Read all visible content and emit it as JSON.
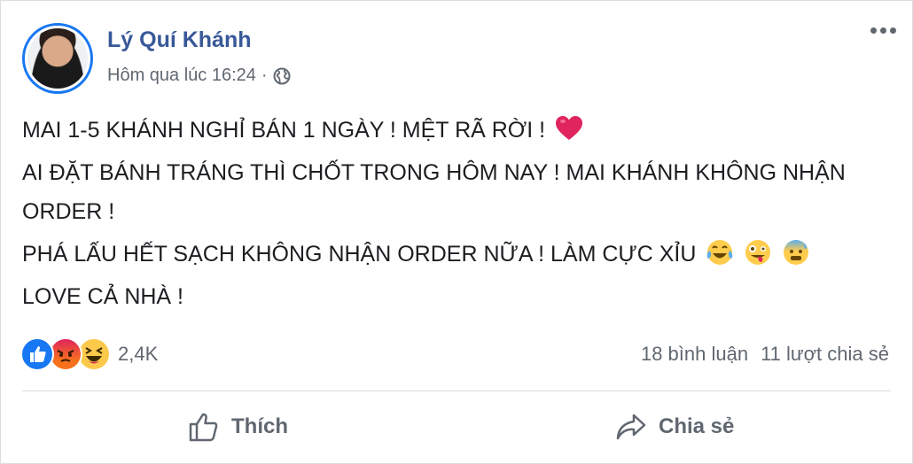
{
  "post": {
    "author": "Lý Quí Khánh",
    "timestamp": "Hôm qua lúc 16:24",
    "separator": "·",
    "privacy_icon": "globe-icon",
    "lines": [
      "MAI 1-5 KHÁNH NGHỈ BÁN 1 NGÀY ! MỆT RÃ RỜI !",
      "AI ĐẶT BÁNH TRÁNG THÌ CHỐT TRONG HÔM NAY ! MAI KHÁNH KHÔNG NHẬN ORDER !",
      "PHÁ LẤU HẾT SẠCH KHÔNG NHẬN ORDER NỮA ! LÀM CỰC XỈU",
      "LOVE CẢ NHÀ !"
    ]
  },
  "reactions": {
    "icons": [
      "like-icon",
      "angry-icon",
      "haha-icon"
    ],
    "count": "2,4K"
  },
  "stats": {
    "comments": "18 bình luận",
    "shares": "11 lượt chia sẻ"
  },
  "actions": {
    "like_label": "Thích",
    "share_label": "Chia sẻ"
  },
  "colors": {
    "name": "#385898",
    "like_blue": "#1877f2",
    "text": "#1c1e21",
    "muted": "#606770"
  }
}
